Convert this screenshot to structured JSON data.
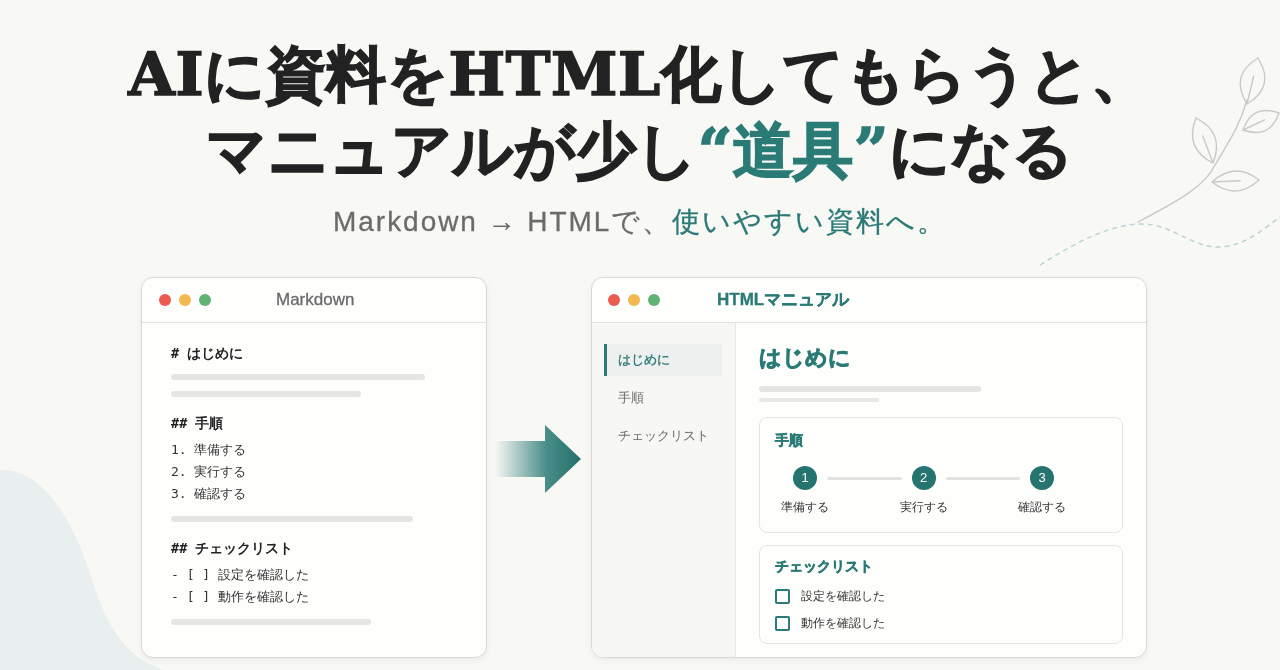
{
  "headline": {
    "lines": [
      [
        {
          "text": "AIに資料をHTML化してもらうと、",
          "accent": false
        }
      ],
      [
        {
          "text": "マニュアルが少し",
          "accent": false
        },
        {
          "text": "“道具”",
          "accent": true
        },
        {
          "text": "になる",
          "accent": false
        }
      ]
    ]
  },
  "subtitle": [
    {
      "text": "Markdown → HTMLで、",
      "accent": false
    },
    {
      "text": "使いやすい資料へ。",
      "accent": true
    }
  ],
  "markdown_window": {
    "title": "Markdown",
    "lines": [
      {
        "kind": "heading",
        "text": "# はじめに"
      },
      {
        "kind": "filler"
      },
      {
        "kind": "filler"
      },
      {
        "kind": "heading",
        "text": "## 手順"
      },
      {
        "kind": "item",
        "text": "1. 準備する"
      },
      {
        "kind": "item",
        "text": "2. 実行する"
      },
      {
        "kind": "item",
        "text": "3. 確認する"
      },
      {
        "kind": "filler"
      },
      {
        "kind": "heading",
        "text": "## チェックリスト"
      },
      {
        "kind": "item",
        "text": "- [ ] 設定を確認した"
      },
      {
        "kind": "item",
        "text": "- [ ] 動作を確認した"
      },
      {
        "kind": "filler"
      }
    ]
  },
  "html_window": {
    "title": "HTMLマニュアル",
    "sidebar": {
      "items": [
        {
          "label": "はじめに",
          "selected": true
        },
        {
          "label": "手順",
          "selected": false
        },
        {
          "label": "チェックリスト",
          "selected": false
        }
      ]
    },
    "heading": "はじめに",
    "steps_card": {
      "title": "手順",
      "steps": [
        {
          "number": "1",
          "label": "準備する"
        },
        {
          "number": "2",
          "label": "実行する"
        },
        {
          "number": "3",
          "label": "確認する"
        }
      ]
    },
    "checklist_card": {
      "title": "チェックリスト",
      "items": [
        {
          "label": "設定を確認した",
          "checked": false
        },
        {
          "label": "動作を確認した",
          "checked": false
        }
      ]
    }
  }
}
